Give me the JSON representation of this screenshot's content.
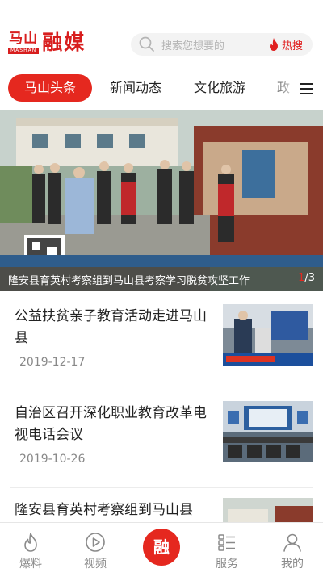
{
  "header": {
    "logo_small": "马山",
    "logo_sub": "MASHAN",
    "logo_big": "融媒",
    "search_placeholder": "搜索您想要的",
    "hot_label": "热搜"
  },
  "tabs": [
    {
      "label": "马山头条",
      "active": true
    },
    {
      "label": "新闻动态",
      "active": false
    },
    {
      "label": "文化旅游",
      "active": false
    },
    {
      "label": "政",
      "active": false
    }
  ],
  "banner": {
    "caption": "隆安县育英村考察组到马山县考察学习脱贫攻坚工作",
    "page_current": "1",
    "page_total": "/3"
  },
  "news": [
    {
      "title": "公益扶贫亲子教育活动走进马山县",
      "date": "2019-12-17"
    },
    {
      "title": "自治区召开深化职业教育改革电视电话会议",
      "date": "2019-10-26"
    },
    {
      "title": "隆安县育英村考察组到马山县",
      "date": ""
    }
  ],
  "tabbar": {
    "items": [
      {
        "label": "爆料",
        "icon": "flame-icon"
      },
      {
        "label": "视频",
        "icon": "play-icon"
      },
      {
        "label": "服务",
        "icon": "grid-list-icon"
      },
      {
        "label": "我的",
        "icon": "user-icon"
      }
    ],
    "center_label": "融"
  },
  "colors": {
    "accent": "#e5281f",
    "muted": "#8a8a8a"
  }
}
